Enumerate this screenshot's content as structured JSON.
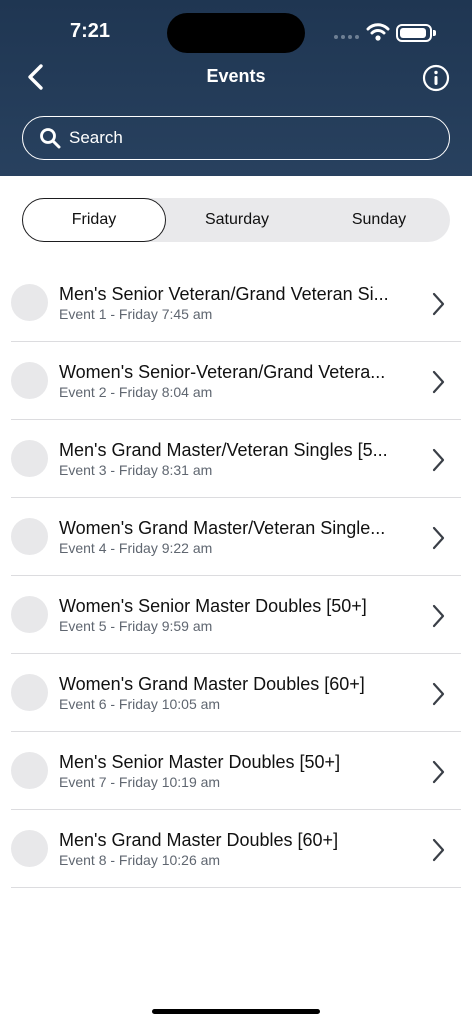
{
  "status": {
    "time": "7:21"
  },
  "header": {
    "title": "Events"
  },
  "search": {
    "placeholder": "Search"
  },
  "tabs": [
    {
      "label": "Friday",
      "active": true
    },
    {
      "label": "Saturday",
      "active": false
    },
    {
      "label": "Sunday",
      "active": false
    }
  ],
  "events": [
    {
      "title": "Men's Senior Veteran/Grand Veteran Si...",
      "subtitle": "Event 1 - Friday 7:45 am"
    },
    {
      "title": "Women's Senior-Veteran/Grand Vetera...",
      "subtitle": "Event 2 - Friday 8:04 am"
    },
    {
      "title": "Men's Grand Master/Veteran Singles [5...",
      "subtitle": "Event 3 - Friday 8:31 am"
    },
    {
      "title": "Women's Grand Master/Veteran Single...",
      "subtitle": "Event 4 - Friday 9:22 am"
    },
    {
      "title": "Women's Senior Master Doubles [50+]",
      "subtitle": "Event 5 - Friday 9:59 am"
    },
    {
      "title": "Women's Grand Master Doubles [60+]",
      "subtitle": "Event 6 - Friday 10:05 am"
    },
    {
      "title": "Men's Senior Master Doubles [50+]",
      "subtitle": "Event 7 - Friday 10:19 am"
    },
    {
      "title": "Men's Grand Master Doubles [60+]",
      "subtitle": "Event 8 - Friday 10:26 am"
    }
  ],
  "icons": {
    "back": "chevron-left-icon",
    "info": "info-icon",
    "search": "search-icon",
    "row": "chevron-right-icon"
  },
  "colors": {
    "header_bg": "#243c5a",
    "segment_bg": "#e9e9eb",
    "subtitle": "#5f6670"
  }
}
